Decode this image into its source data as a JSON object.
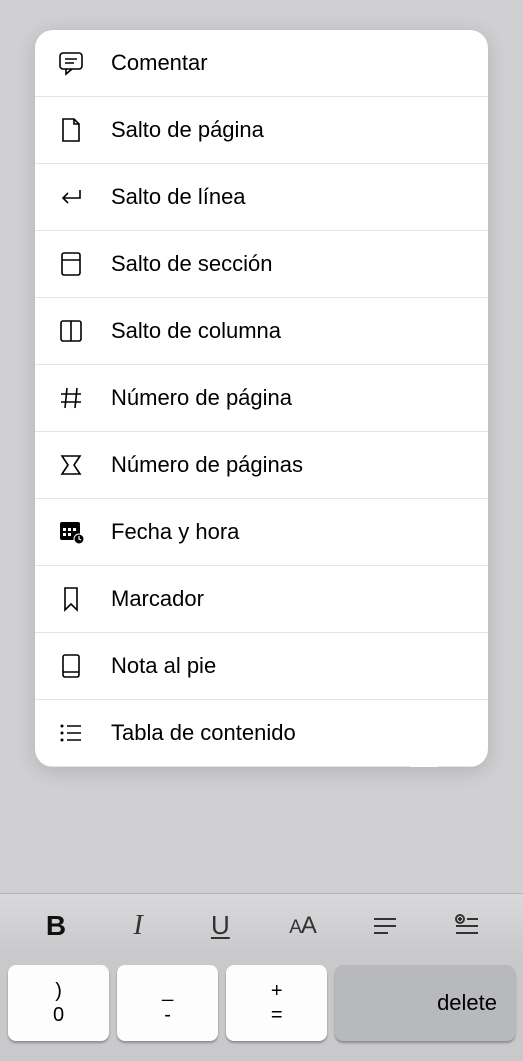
{
  "menu": {
    "items": [
      {
        "icon": "comment-icon",
        "label": "Comentar"
      },
      {
        "icon": "page-break-icon",
        "label": "Salto de página"
      },
      {
        "icon": "line-break-icon",
        "label": "Salto de línea"
      },
      {
        "icon": "section-break-icon",
        "label": "Salto de sección"
      },
      {
        "icon": "column-break-icon",
        "label": "Salto de columna"
      },
      {
        "icon": "page-number-icon",
        "label": "Número de página"
      },
      {
        "icon": "page-count-icon",
        "label": "Número de páginas"
      },
      {
        "icon": "datetime-icon",
        "label": "Fecha y hora"
      },
      {
        "icon": "bookmark-icon",
        "label": "Marcador"
      },
      {
        "icon": "footnote-icon",
        "label": "Nota al pie"
      },
      {
        "icon": "toc-icon",
        "label": "Tabla de contenido"
      }
    ]
  },
  "toolbar": {
    "bold": "B",
    "italic": "I",
    "underline": "U",
    "fontcase_large": "A",
    "fontcase_small": "A"
  },
  "keyboard": {
    "keys": [
      {
        "top": ")",
        "bottom": "0"
      },
      {
        "top": "_",
        "bottom": "-"
      },
      {
        "top": "+",
        "bottom": "="
      }
    ],
    "delete_label": "delete"
  }
}
